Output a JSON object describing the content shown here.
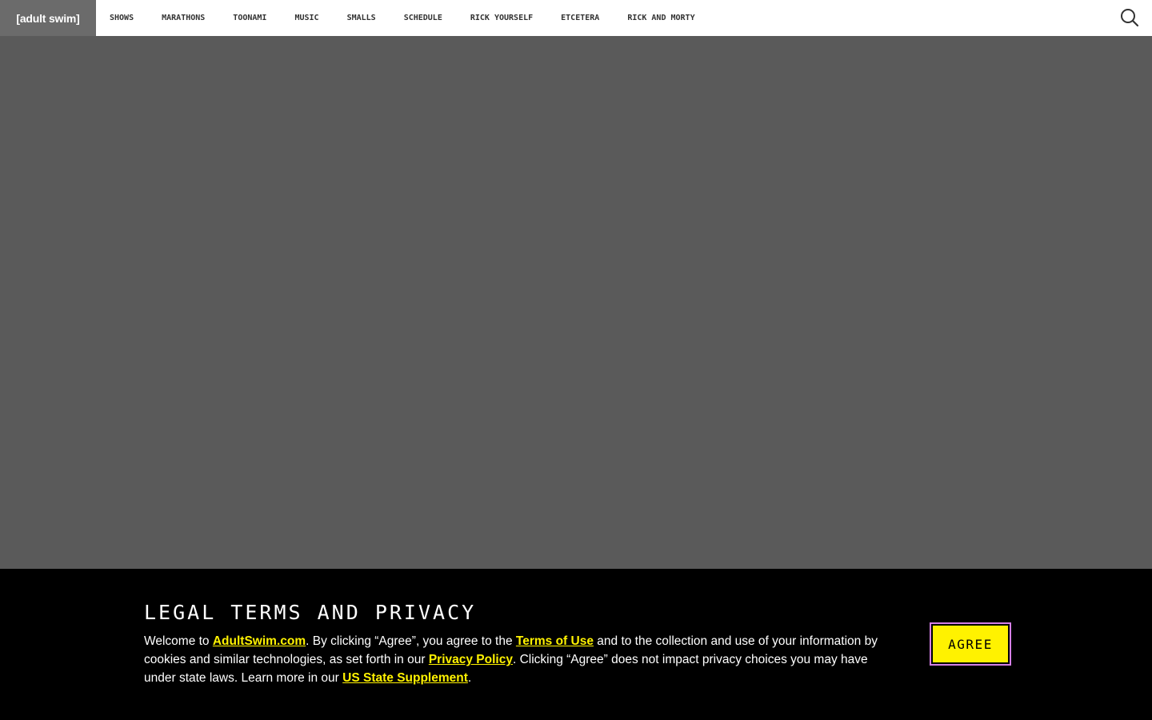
{
  "header": {
    "logo": "[adult swim]",
    "nav": [
      "SHOWS",
      "MARATHONS",
      "TOONAMI",
      "MUSIC",
      "SMALLS",
      "SCHEDULE",
      "RICK YOURSELF",
      "ETCETERA",
      "RICK AND MORTY"
    ],
    "search_icon": "search-icon"
  },
  "consent": {
    "title": "LEGAL TERMS AND PRIVACY",
    "p1": "Welcome to ",
    "link_site": "AdultSwim.com",
    "p2": ". By clicking “Agree”, you agree to the ",
    "link_terms": "Terms of Use",
    "p3": " and to the collection and use of your information by cookies and similar technologies, as set forth in our ",
    "link_privacy": "Privacy Policy",
    "p4": ". Clicking “Agree” does not impact privacy choices you may have under state laws. Learn more in our ",
    "link_supplement": "US State Supplement",
    "p5": ".",
    "agree_label": "AGREE"
  },
  "colors": {
    "accent": "#fff200",
    "focus_ring": "#d47fe6",
    "page_bg": "#5a5a5a",
    "banner_bg": "#000000"
  }
}
